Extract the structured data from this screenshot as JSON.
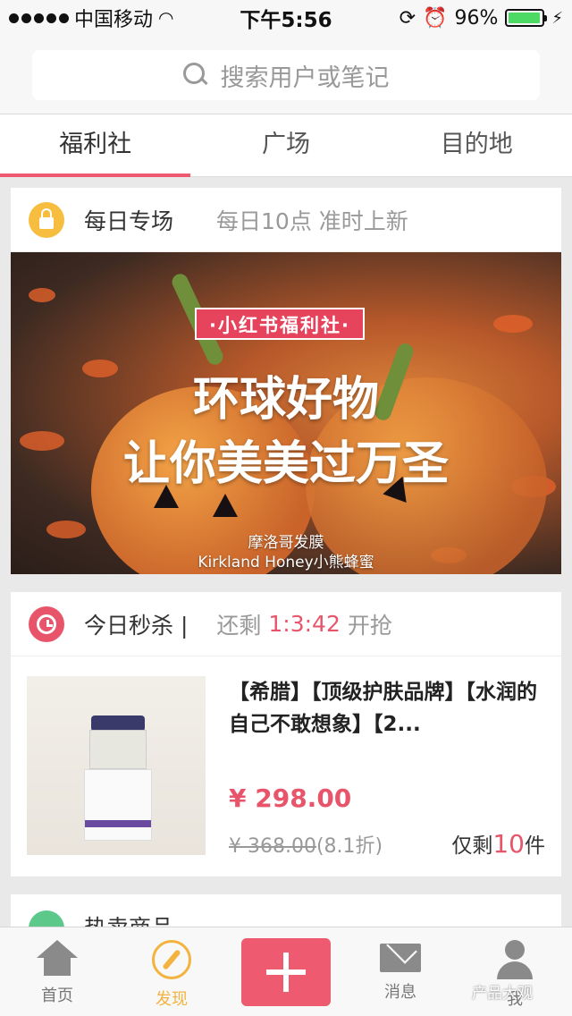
{
  "status_bar": {
    "carrier": "中国移动",
    "time": "下午5:56",
    "battery": "96%",
    "battery_level": 0.96
  },
  "search": {
    "placeholder": "搜索用户或笔记"
  },
  "tabs": [
    {
      "label": "福利社",
      "active": true
    },
    {
      "label": "广场",
      "active": false
    },
    {
      "label": "目的地",
      "active": false
    }
  ],
  "daily": {
    "title": "每日专场",
    "subtitle": "每日10点 准时上新",
    "banner": {
      "tag": "·小红书福利社·",
      "line1": "环球好物",
      "line2": "让你美美过万圣",
      "caption1": "摩洛哥发膜",
      "caption2": "Kirkland Honey小熊蜂蜜"
    }
  },
  "flash_sale": {
    "title": "今日秒杀 |",
    "remaining_label": "还剩",
    "countdown": "1:3:42",
    "start_label": "开抢",
    "product": {
      "name": "【希腊】【顶级护肤品牌】【水润的自己不敢想象】【2...",
      "price": "¥ 298.00",
      "original_price": "¥ 368.00",
      "discount": "(8.1折)",
      "stock_prefix": "仅剩",
      "stock_count": "10",
      "stock_suffix": "件"
    }
  },
  "hot_products": {
    "title": "热卖商品"
  },
  "bottom_nav": {
    "home": "首页",
    "discover": "发现",
    "messages": "消息",
    "me": "我"
  },
  "watermark": "产品大观",
  "colors": {
    "accent": "#ee5a6f",
    "gold": "#f3b33e",
    "lock_icon": "#f7bd3e",
    "clock_icon": "#e8546a"
  }
}
